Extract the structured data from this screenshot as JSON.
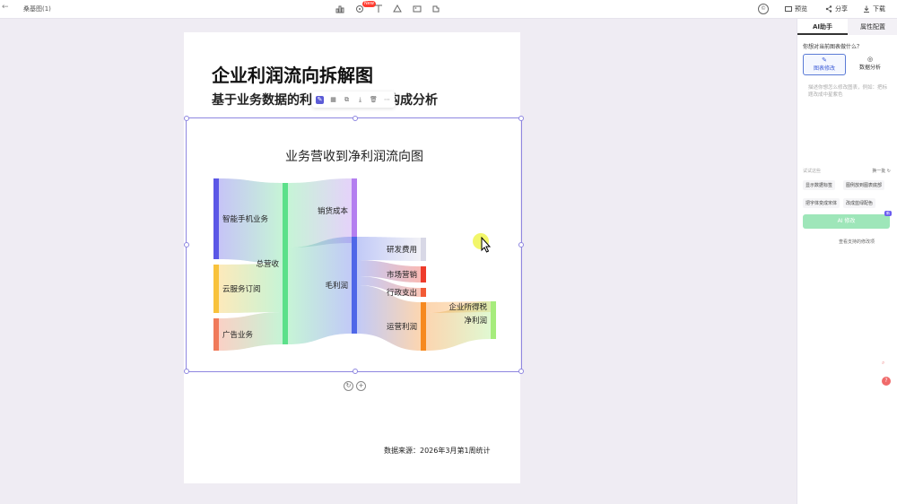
{
  "window": {
    "back": "←",
    "doc_title": "桑基图(1)"
  },
  "toolbar": {
    "icons": [
      "chart-icon",
      "element-icon",
      "text-icon",
      "shape-icon",
      "image-icon",
      "plugin-icon"
    ],
    "new_badge": "New",
    "preview_label": "预览",
    "share_label": "分享",
    "download_label": "下载",
    "copyright": "©"
  },
  "page": {
    "title": "企业利润流向拆解图",
    "subtitle_left": "基于业务数据的利",
    "subtitle_right": "构成分析",
    "source": "数据来源：2026年3月第1周统计"
  },
  "chart_data": {
    "type": "sankey",
    "title": "业务营收到净利润流向图",
    "nodes": [
      {
        "name": "智能手机业务",
        "color": "#5b57e6"
      },
      {
        "name": "云服务订阅",
        "color": "#f8c23c"
      },
      {
        "name": "广告业务",
        "color": "#f07a5a"
      },
      {
        "name": "总营收",
        "color": "#5ce08a"
      },
      {
        "name": "销货成本",
        "color": "#b47ff0"
      },
      {
        "name": "毛利润",
        "color": "#4f67e8"
      },
      {
        "name": "研发费用",
        "color": "#d8d8e6"
      },
      {
        "name": "市场营销",
        "color": "#ee3b2b"
      },
      {
        "name": "行政支出",
        "color": "#f25a35"
      },
      {
        "name": "运营利润",
        "color": "#f6891f"
      },
      {
        "name": "企业所得税",
        "color": "#f8c46a"
      },
      {
        "name": "净利润",
        "color": "#a6ec7c"
      }
    ],
    "links": [
      {
        "source": "智能手机业务",
        "target": "总营收",
        "value": 45
      },
      {
        "source": "云服务订阅",
        "target": "总营收",
        "value": 27
      },
      {
        "source": "广告业务",
        "target": "总营收",
        "value": 18
      },
      {
        "source": "总营收",
        "target": "销货成本",
        "value": 36
      },
      {
        "source": "总营收",
        "target": "毛利润",
        "value": 54
      },
      {
        "source": "毛利润",
        "target": "研发费用",
        "value": 13
      },
      {
        "source": "毛利润",
        "target": "市场营销",
        "value": 9
      },
      {
        "source": "毛利润",
        "target": "行政支出",
        "value": 5
      },
      {
        "source": "毛利润",
        "target": "运营利润",
        "value": 27
      },
      {
        "source": "运营利润",
        "target": "企业所得税",
        "value": 6
      },
      {
        "source": "运营利润",
        "target": "净利润",
        "value": 21
      }
    ]
  },
  "selection_toolbar": [
    "ai-icon",
    "table-icon",
    "copy-icon",
    "download-icon",
    "delete-icon",
    "more-icon"
  ],
  "right_panel": {
    "tabs": [
      "AI助手",
      "属性配置"
    ],
    "question": "你想对当前图表做什么？",
    "modes": [
      {
        "label": "图表修改",
        "icon": "✎"
      },
      {
        "label": "数据分析",
        "icon": "◎"
      }
    ],
    "prompt_placeholder": "描述你想怎么修改图表，例如：把标题改成中星紫色",
    "suggest_title": "试试这些",
    "suggest_refresh": "换一批 ↻",
    "suggestions": [
      "显示数据标签",
      "图例放到图表底部",
      "把字体变成宋体",
      "改成蓝绿配色"
    ],
    "ai_button": "AI 修改",
    "ai_badge": "新",
    "more_link": "查看支持的修改项"
  }
}
